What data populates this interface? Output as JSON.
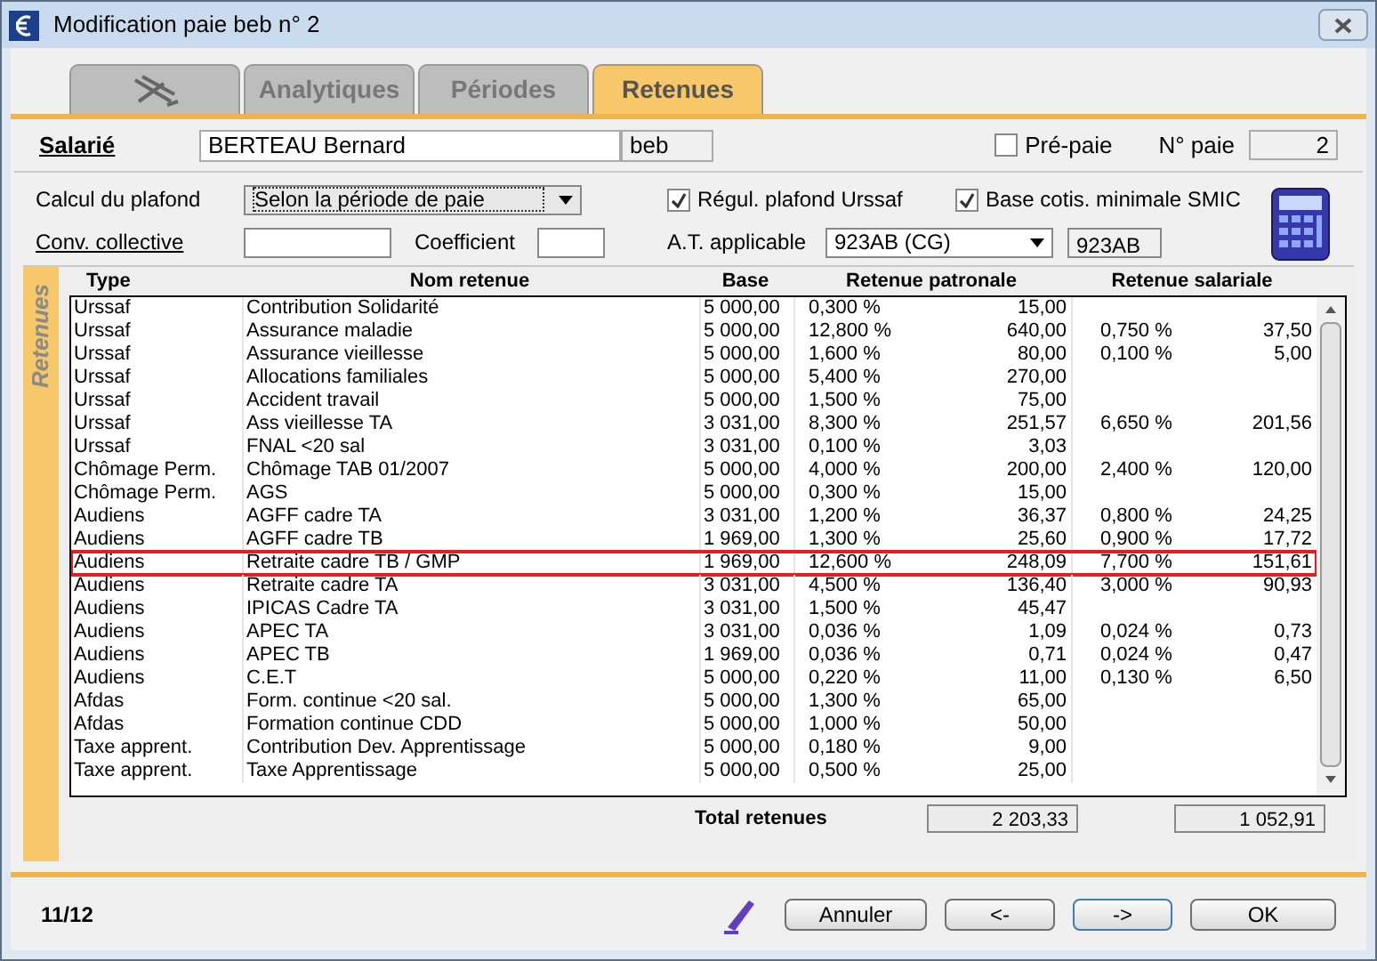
{
  "window": {
    "title": "Modification paie beb n° 2"
  },
  "tabs": [
    {
      "kind": "icon",
      "selected": false
    },
    {
      "kind": "text",
      "label": "Analytiques",
      "selected": false
    },
    {
      "kind": "text",
      "label": "Périodes",
      "selected": false
    },
    {
      "kind": "text",
      "label": "Retenues",
      "selected": true
    }
  ],
  "employee": {
    "label": "Salarié",
    "name": "BERTEAU Bernard",
    "code": "beb",
    "prepay": {
      "label": "Pré-paie",
      "checked": false
    },
    "pay_number": {
      "label": "N° paie",
      "value": "2"
    }
  },
  "settings": {
    "ceiling": {
      "label": "Calcul du plafond",
      "value": "Selon la période de paie"
    },
    "regul": {
      "label": "Régul. plafond Urssaf",
      "checked": true
    },
    "base_min": {
      "label": "Base cotis. minimale SMIC",
      "checked": true
    },
    "convention": {
      "label": "Conv. collective"
    },
    "coefficient": {
      "label": "Coefficient"
    },
    "at": {
      "label": "A.T. applicable",
      "value": "923AB (CG)",
      "code": "923AB"
    }
  },
  "side_label": "Retenues",
  "table": {
    "columns": [
      "Type",
      "Nom retenue",
      "Base",
      "Retenue patronale",
      "Retenue salariale"
    ],
    "rows": [
      {
        "type": "Urssaf",
        "name": "Contribution Solidarité",
        "base": "5 000,00",
        "employer_rate": "0,300 %",
        "employer_amount": "15,00",
        "selected": false
      },
      {
        "type": "Urssaf",
        "name": "Assurance maladie",
        "base": "5 000,00",
        "employer_rate": "12,800 %",
        "employer_amount": "640,00",
        "employee_rate": "0,750 %",
        "employee_amount": "37,50",
        "selected": false
      },
      {
        "type": "Urssaf",
        "name": "Assurance vieillesse",
        "base": "5 000,00",
        "employer_rate": "1,600 %",
        "employer_amount": "80,00",
        "employee_rate": "0,100 %",
        "employee_amount": "5,00",
        "selected": false
      },
      {
        "type": "Urssaf",
        "name": "Allocations familiales",
        "base": "5 000,00",
        "employer_rate": "5,400 %",
        "employer_amount": "270,00",
        "selected": false
      },
      {
        "type": "Urssaf",
        "name": "Accident travail",
        "base": "5 000,00",
        "employer_rate": "1,500 %",
        "employer_amount": "75,00",
        "selected": false
      },
      {
        "type": "Urssaf",
        "name": "Ass vieillesse TA",
        "base": "3 031,00",
        "employer_rate": "8,300 %",
        "employer_amount": "251,57",
        "employee_rate": "6,650 %",
        "employee_amount": "201,56",
        "selected": false
      },
      {
        "type": "Urssaf",
        "name": "FNAL <20 sal",
        "base": "3 031,00",
        "employer_rate": "0,100 %",
        "employer_amount": "3,03",
        "selected": false
      },
      {
        "type": "Chômage Perm.",
        "name": "Chômage TAB 01/2007",
        "base": "5 000,00",
        "employer_rate": "4,000 %",
        "employer_amount": "200,00",
        "employee_rate": "2,400 %",
        "employee_amount": "120,00",
        "selected": false
      },
      {
        "type": "Chômage Perm.",
        "name": "AGS",
        "base": "5 000,00",
        "employer_rate": "0,300 %",
        "employer_amount": "15,00",
        "selected": false
      },
      {
        "type": "Audiens",
        "name": "AGFF cadre TA",
        "base": "3 031,00",
        "employer_rate": "1,200 %",
        "employer_amount": "36,37",
        "employee_rate": "0,800 %",
        "employee_amount": "24,25",
        "selected": false
      },
      {
        "type": "Audiens",
        "name": "AGFF cadre TB",
        "base": "1 969,00",
        "employer_rate": "1,300 %",
        "employer_amount": "25,60",
        "employee_rate": "0,900 %",
        "employee_amount": "17,72",
        "selected": false
      },
      {
        "type": "Audiens",
        "name": "Retraite cadre TB / GMP",
        "base": "1 969,00",
        "employer_rate": "12,600 %",
        "employer_amount": "248,09",
        "employee_rate": "7,700 %",
        "employee_amount": "151,61",
        "selected": true
      },
      {
        "type": "Audiens",
        "name": "Retraite cadre TA",
        "base": "3 031,00",
        "employer_rate": "4,500 %",
        "employer_amount": "136,40",
        "employee_rate": "3,000 %",
        "employee_amount": "90,93",
        "selected": false
      },
      {
        "type": "Audiens",
        "name": "IPICAS Cadre TA",
        "base": "3 031,00",
        "employer_rate": "1,500 %",
        "employer_amount": "45,47",
        "selected": false
      },
      {
        "type": "Audiens",
        "name": "APEC TA",
        "base": "3 031,00",
        "employer_rate": "0,036 %",
        "employer_amount": "1,09",
        "employee_rate": "0,024 %",
        "employee_amount": "0,73",
        "selected": false
      },
      {
        "type": "Audiens",
        "name": "APEC TB",
        "base": "1 969,00",
        "employer_rate": "0,036 %",
        "employer_amount": "0,71",
        "employee_rate": "0,024 %",
        "employee_amount": "0,47",
        "selected": false
      },
      {
        "type": "Audiens",
        "name": "C.E.T",
        "base": "5 000,00",
        "employer_rate": "0,220 %",
        "employer_amount": "11,00",
        "employee_rate": "0,130 %",
        "employee_amount": "6,50",
        "selected": false
      },
      {
        "type": "Afdas",
        "name": "Form. continue <20 sal.",
        "base": "5 000,00",
        "employer_rate": "1,300 %",
        "employer_amount": "65,00",
        "selected": false
      },
      {
        "type": "Afdas",
        "name": "Formation continue CDD",
        "base": "5 000,00",
        "employer_rate": "1,000 %",
        "employer_amount": "50,00",
        "selected": false
      },
      {
        "type": "Taxe apprent.",
        "name": "Contribution Dev. Apprentissage",
        "base": "5 000,00",
        "employer_rate": "0,180 %",
        "employer_amount": "9,00",
        "selected": false
      },
      {
        "type": "Taxe apprent.",
        "name": "Taxe Apprentissage",
        "base": "5 000,00",
        "employer_rate": "0,500 %",
        "employer_amount": "25,00",
        "selected": false
      }
    ],
    "total": {
      "label": "Total retenues",
      "employer": "2 203,33",
      "employee": "1 052,91"
    }
  },
  "footer": {
    "counter": "11/12",
    "buttons": [
      {
        "label": "Annuler",
        "selected": false
      },
      {
        "label": "<-",
        "selected": false
      },
      {
        "label": "->",
        "selected": true
      },
      {
        "label": "OK",
        "selected": false
      }
    ]
  }
}
